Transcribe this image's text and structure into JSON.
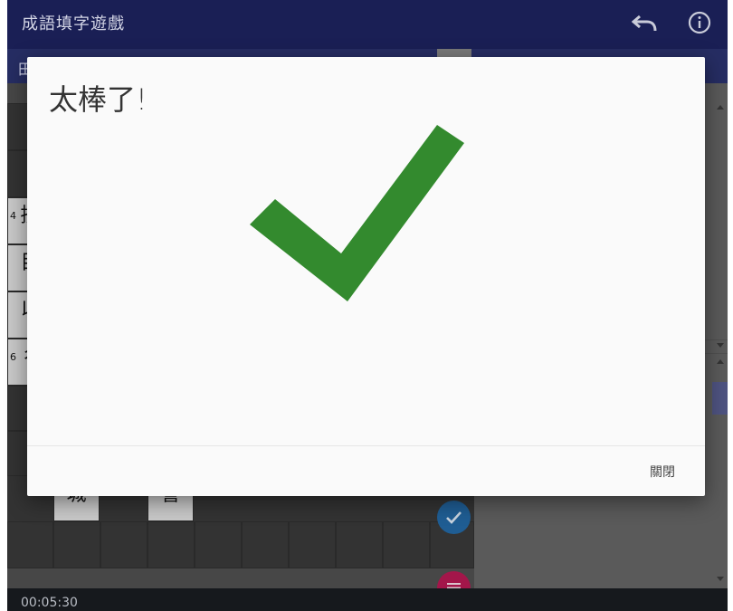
{
  "app": {
    "title": "成語填字遊戲"
  },
  "toolbar": {
    "undo_icon": "undo-icon",
    "info_icon": "info-icon"
  },
  "subbar": {
    "text": "田"
  },
  "board": {
    "cells": [
      {
        "num": "4",
        "char": "摃"
      },
      {
        "num": "",
        "char": "目"
      },
      {
        "num": "",
        "char": "以"
      },
      {
        "num": "6",
        "char": "彳"
      },
      {
        "num": "",
        "char": "城"
      },
      {
        "num": "",
        "char": "誉"
      }
    ]
  },
  "fab": {
    "check_icon": "check-icon",
    "menu_icon": "menu-icon"
  },
  "status": {
    "timer": "00:05:30"
  },
  "dialog": {
    "title": "太棒了!",
    "icon": "check-mark-icon",
    "close_label": "關閉",
    "accent_color": "#338a2e"
  }
}
